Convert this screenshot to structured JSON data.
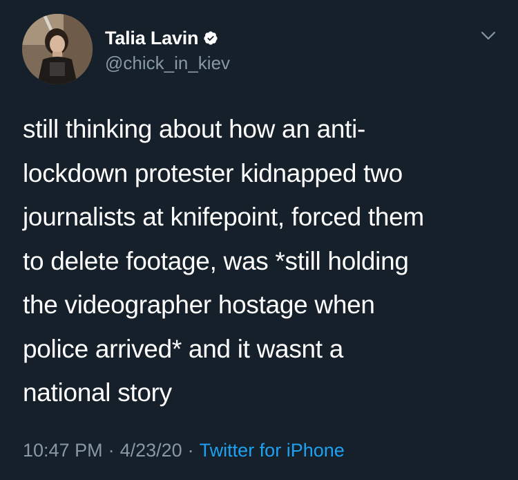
{
  "author": {
    "display_name": "Talia Lavin",
    "handle": "@chick_in_kiev",
    "verified": true,
    "avatar_icon": "profile-photo"
  },
  "tweet": {
    "text": "still thinking about how an anti-\nlockdown protester kidnapped two\njournalists at knifepoint, forced them\nto delete footage, was *still holding\nthe videographer hostage when\npolice arrived* and it wasnt a\nnational story"
  },
  "meta": {
    "time": "10:47 PM",
    "separator": "·",
    "date": "4/23/20",
    "source": "Twitter for iPhone"
  },
  "colors": {
    "background": "#15202b",
    "text": "#ffffff",
    "secondary": "#8899a6",
    "accent": "#1da1f2"
  },
  "icons": {
    "verified": "verified-badge-icon",
    "menu": "chevron-down-icon"
  }
}
